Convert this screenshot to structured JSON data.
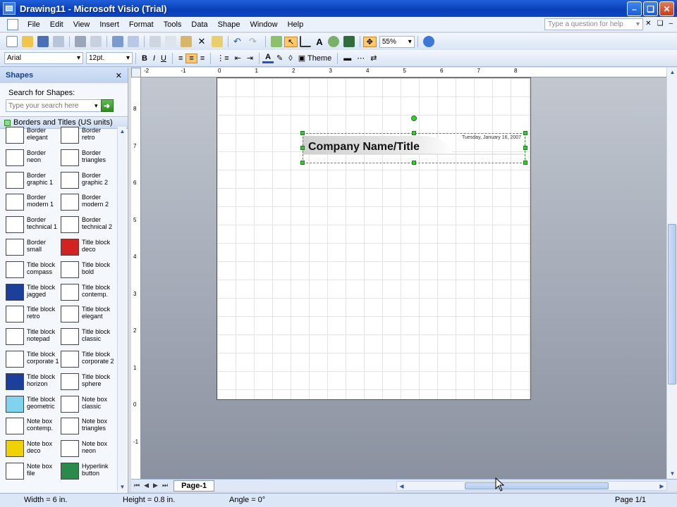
{
  "window": {
    "title": "Drawing11 - Microsoft Visio (Trial)",
    "help_placeholder": "Type a question for help"
  },
  "menu": [
    "File",
    "Edit",
    "View",
    "Insert",
    "Format",
    "Tools",
    "Data",
    "Shape",
    "Window",
    "Help"
  ],
  "toolbar": {
    "zoom": "55%",
    "font": "Arial",
    "font_size": "12pt.",
    "bold": "B",
    "italic": "I",
    "underline": "U",
    "theme": "Theme"
  },
  "shapes_panel": {
    "title": "Shapes",
    "search_label": "Search for Shapes:",
    "search_placeholder": "Type your search here",
    "stencil_title": "Borders and Titles (US units)",
    "items": [
      {
        "line1": "Border",
        "line2": "elegant"
      },
      {
        "line1": "Border",
        "line2": "retro"
      },
      {
        "line1": "Border",
        "line2": "neon"
      },
      {
        "line1": "Border",
        "line2": "triangles"
      },
      {
        "line1": "Border",
        "line2": "graphic 1"
      },
      {
        "line1": "Border",
        "line2": "graphic 2"
      },
      {
        "line1": "Border",
        "line2": "modern 1"
      },
      {
        "line1": "Border",
        "line2": "modern 2"
      },
      {
        "line1": "Border",
        "line2": "technical 1"
      },
      {
        "line1": "Border",
        "line2": "technical 2"
      },
      {
        "line1": "Border",
        "line2": "small"
      },
      {
        "line1": "Title block",
        "line2": "deco"
      },
      {
        "line1": "Title block",
        "line2": "compass"
      },
      {
        "line1": "Title block",
        "line2": "bold"
      },
      {
        "line1": "Title block",
        "line2": "jagged"
      },
      {
        "line1": "Title block",
        "line2": "contemp."
      },
      {
        "line1": "Title block",
        "line2": "retro"
      },
      {
        "line1": "Title block",
        "line2": "elegant"
      },
      {
        "line1": "Title block",
        "line2": "notepad"
      },
      {
        "line1": "Title block",
        "line2": "classic"
      },
      {
        "line1": "Title block",
        "line2": "corporate 1"
      },
      {
        "line1": "Title block",
        "line2": "corporate 2"
      },
      {
        "line1": "Title block",
        "line2": "horizon"
      },
      {
        "line1": "Title block",
        "line2": "sphere"
      },
      {
        "line1": "Title block",
        "line2": "geometric"
      },
      {
        "line1": "Note box",
        "line2": "classic"
      },
      {
        "line1": "Note box",
        "line2": "contemp."
      },
      {
        "line1": "Note box",
        "line2": "triangles"
      },
      {
        "line1": "Note box",
        "line2": "deco"
      },
      {
        "line1": "Note box",
        "line2": "neon"
      },
      {
        "line1": "Note box",
        "line2": "file"
      },
      {
        "line1": "Hyperlink",
        "line2": "button"
      }
    ]
  },
  "drawing": {
    "title_text": "Company Name/Title",
    "date_text": "Tuesday, January 16, 2007",
    "ruler_h": [
      "-2",
      "-1",
      "0",
      "1",
      "2",
      "3",
      "4",
      "5",
      "6",
      "7",
      "8"
    ],
    "ruler_v": [
      "8",
      "7",
      "6",
      "5",
      "4",
      "3",
      "2",
      "1",
      "0",
      "-1"
    ]
  },
  "page_tab": "Page-1",
  "status": {
    "width": "Width = 6 in.",
    "height": "Height = 0.8 in.",
    "angle": "Angle = 0°",
    "page": "Page 1/1"
  }
}
